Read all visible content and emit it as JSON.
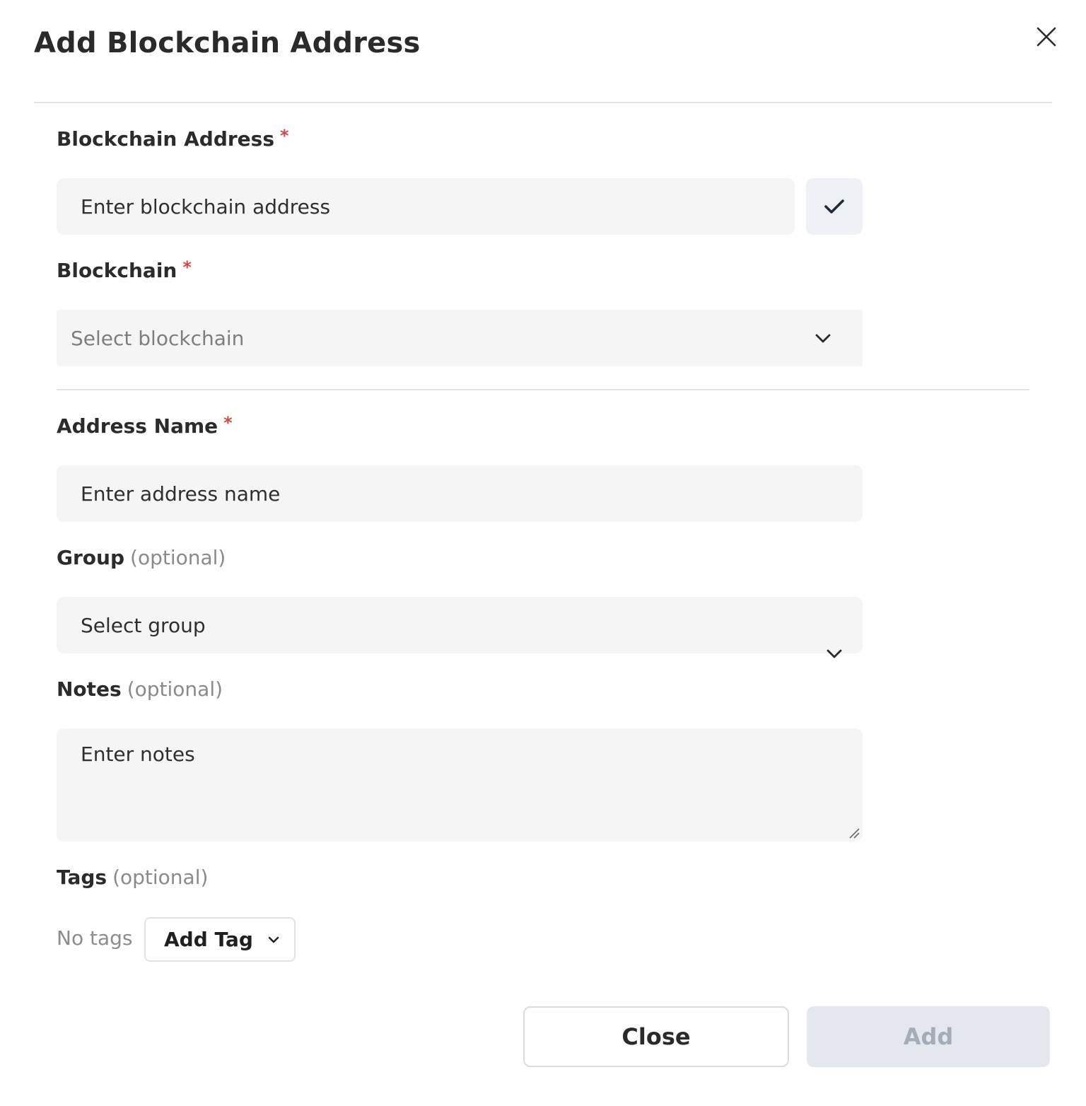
{
  "dialog": {
    "title": "Add Blockchain Address"
  },
  "fields": {
    "address": {
      "label": "Blockchain Address",
      "required_marker": "*",
      "placeholder": "Enter blockchain address"
    },
    "blockchain": {
      "label": "Blockchain",
      "required_marker": "*",
      "placeholder": "Select blockchain"
    },
    "address_name": {
      "label": "Address Name",
      "required_marker": "*",
      "placeholder": "Enter address name"
    },
    "group": {
      "label": "Group",
      "optional": "(optional)",
      "placeholder": "Select group"
    },
    "notes": {
      "label": "Notes",
      "optional": "(optional)",
      "placeholder": "Enter notes"
    },
    "tags": {
      "label": "Tags",
      "optional": "(optional)",
      "empty_text": "No tags",
      "add_label": "Add Tag"
    }
  },
  "footer": {
    "close_label": "Close",
    "add_label": "Add"
  },
  "icons": {
    "close": "close-icon",
    "verify": "check-icon",
    "dropdown": "chevron-down-icon",
    "resize": "resize-handle-icon"
  },
  "colors": {
    "required": "#d64545",
    "field_bg": "#f5f5f5",
    "add_disabled_bg": "#e4e8ee",
    "add_disabled_text": "#a4acb8"
  }
}
